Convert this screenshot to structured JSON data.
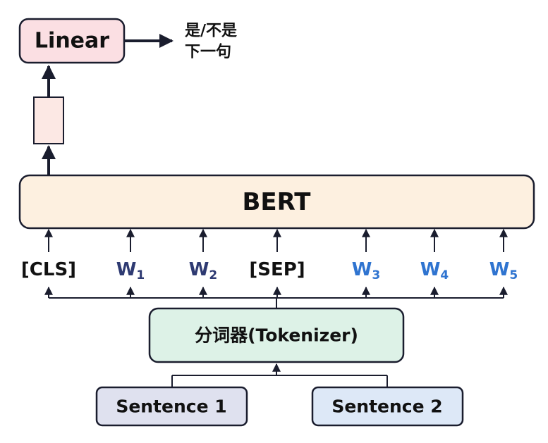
{
  "colors": {
    "stroke": "#1a1d2e",
    "linear_fill": "#fbdfe3",
    "cls_vector_fill": "#fce8e4",
    "bert_fill": "#fdf0e0",
    "tokenizer_fill": "#ddf2e7",
    "sentence1_fill": "#dfe1ef",
    "sentence2_fill": "#dde8f7",
    "token_text_default": "#111111",
    "token_text_sentence1": "#2e3a72",
    "token_text_sentence2": "#2f74d0"
  },
  "linear": {
    "label": "Linear"
  },
  "output": {
    "line1": "是/不是",
    "line2": "下一句"
  },
  "bert": {
    "label": "BERT"
  },
  "tokenizer": {
    "label": "分词器(Tokenizer)"
  },
  "sentences": [
    {
      "label": "Sentence 1"
    },
    {
      "label": "Sentence 2"
    }
  ],
  "tokens": [
    {
      "base": "[CLS]",
      "sub": "",
      "group": "special"
    },
    {
      "base": "W",
      "sub": "1",
      "group": "sentence1"
    },
    {
      "base": "W",
      "sub": "2",
      "group": "sentence1"
    },
    {
      "base": "[SEP]",
      "sub": "",
      "group": "special"
    },
    {
      "base": "W",
      "sub": "3",
      "group": "sentence2"
    },
    {
      "base": "W",
      "sub": "4",
      "group": "sentence2"
    },
    {
      "base": "W",
      "sub": "5",
      "group": "sentence2"
    }
  ]
}
